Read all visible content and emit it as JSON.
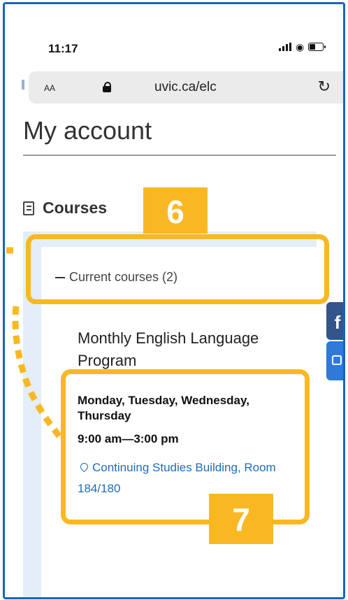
{
  "status_bar": {
    "time": "11:17"
  },
  "browser": {
    "text_size_label": "AA",
    "url": "uvic.ca/elc",
    "reload_icon": "reload-icon"
  },
  "page": {
    "title": "My account",
    "section_heading": "Courses",
    "toggle_label": "Current courses (2)",
    "course": {
      "name": "Monthly English Language Program",
      "days": "Monday, Tuesday, Wednesday, Thursday",
      "hours": "9:00 am—3:00 pm",
      "location": "Continuing Studies Building, Room 184/180"
    }
  },
  "social": {
    "facebook_label": "f"
  },
  "annotations": {
    "callout_6": "6",
    "callout_7": "7",
    "color": "#f9b823"
  },
  "colors": {
    "frame_border": "#1565c0",
    "link": "#1d6db5",
    "panel_background": "#e3eef8"
  }
}
